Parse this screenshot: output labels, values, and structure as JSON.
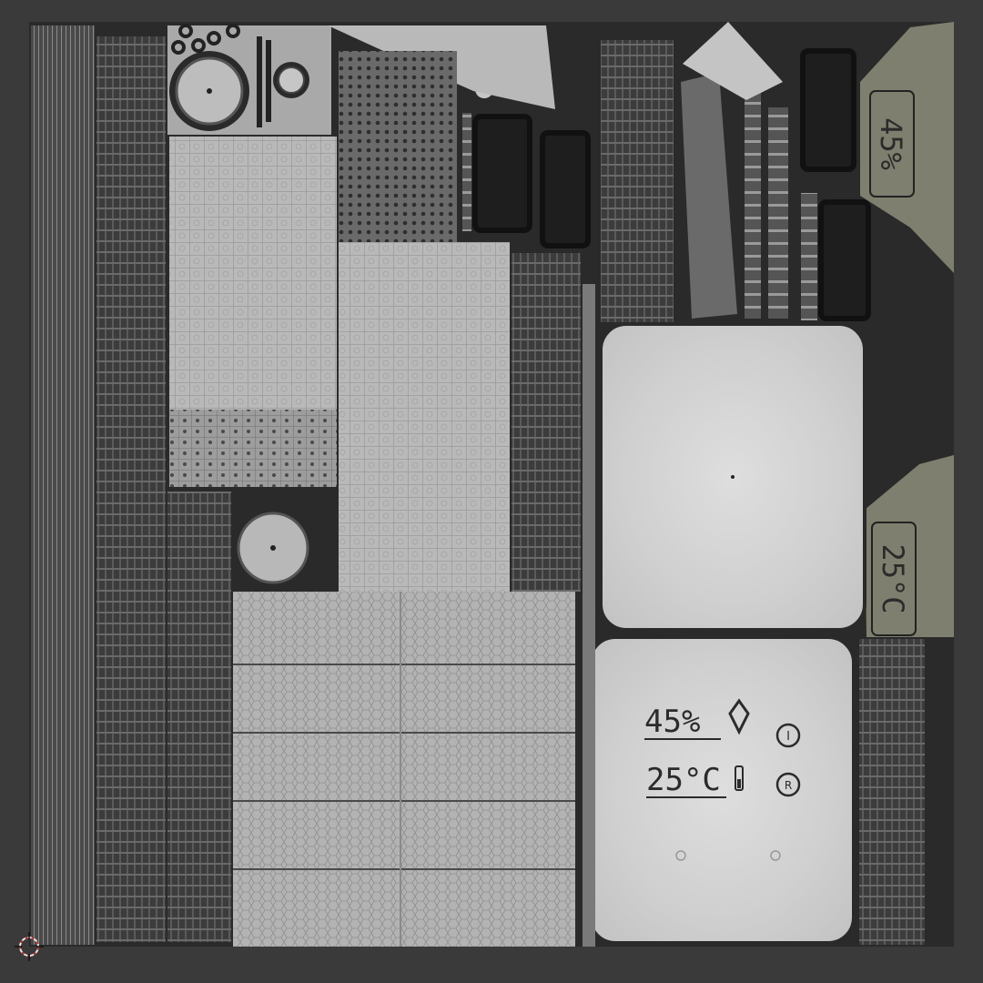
{
  "texture": {
    "background_color": "#3a3a3a",
    "uv_area_color": "#2a2a2a",
    "mesh_light_color": "#bdbdbd",
    "mesh_dark_color": "#505050",
    "olive_color": "#7e7f6e"
  },
  "device": {
    "humidity_reading": "45%",
    "temperature_reading": "25°C",
    "side_humidity_reading": "45%",
    "side_temperature_reading": "25°C",
    "power_button_glyph": "I",
    "reset_button_glyph": "R"
  },
  "icons": {
    "origin_cursor": "crosshair-icon",
    "droplet": "droplet-icon",
    "thermometer": "thermometer-icon"
  }
}
